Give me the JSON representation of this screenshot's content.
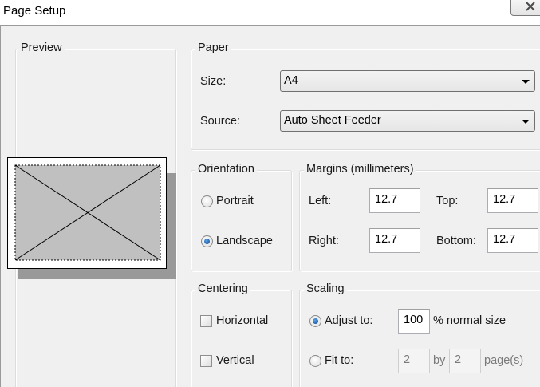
{
  "window": {
    "title": "Page Setup",
    "close_label": "×"
  },
  "preview": {
    "legend": "Preview"
  },
  "paper": {
    "legend": "Paper",
    "size_label": "Size:",
    "size_value": "A4",
    "source_label": "Source:",
    "source_value": "Auto Sheet Feeder"
  },
  "orientation": {
    "legend": "Orientation",
    "portrait_label": "Portrait",
    "landscape_label": "Landscape",
    "selected": "Landscape"
  },
  "margins": {
    "legend": "Margins (millimeters)",
    "left_label": "Left:",
    "left_value": "12.7",
    "top_label": "Top:",
    "top_value": "12.7",
    "right_label": "Right:",
    "right_value": "12.7",
    "bottom_label": "Bottom:",
    "bottom_value": "12.7"
  },
  "centering": {
    "legend": "Centering",
    "horizontal_label": "Horizontal",
    "vertical_label": "Vertical"
  },
  "scaling": {
    "legend": "Scaling",
    "adjust_label": "Adjust to:",
    "adjust_value": "100",
    "adjust_suffix": "% normal size",
    "fit_label": "Fit to:",
    "fit_wide": "2",
    "by_label": "by",
    "fit_tall": "2",
    "pages_label": "page(s)",
    "selected": "Adjust to"
  },
  "colors": {
    "dialog_bg": "#f0f0f0",
    "radio_dot": "#1f5ea8",
    "preview_fill": "#c0c0c0",
    "preview_shadow": "#999999"
  }
}
